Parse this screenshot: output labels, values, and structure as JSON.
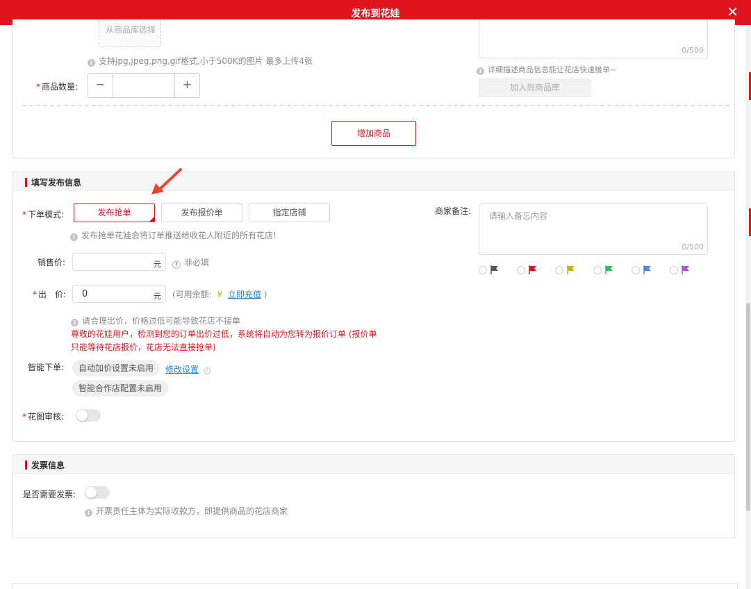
{
  "window": {
    "title": "发布到花娃",
    "close_symbol": "✕"
  },
  "product": {
    "library_select_label": "从商品库选择",
    "upload_hint": "支持jpg,jpeg,png,gif格式,小于500K的图片 最多上传4张",
    "description_count": "0/500",
    "description_hint": "详细描述商品信息能让花店快速接单~",
    "add_to_library_label": "加入到商品库",
    "quantity_label": "商品数量:",
    "quantity_value": "",
    "minus_symbol": "−",
    "plus_symbol": "+",
    "add_product_label": "增加商品"
  },
  "publish": {
    "section_title": "填写发布信息",
    "order_mode_label": "下单模式:",
    "modes": [
      "发布抢单",
      "发布报价单",
      "指定店铺"
    ],
    "selected_mode": "发布抢单",
    "mode_hint": "发布抢单花娃会将订单推送给收花人附近的所有花店!",
    "sale_price_label": "销售价:",
    "sale_price_value": "",
    "currency_unit": "元",
    "optional_hint": "非必填",
    "offer_label": "出　价:",
    "offer_value": "0",
    "balance_prefix": "(可用余额:",
    "balance_symbol": "¥",
    "recharge_link": "立即充值",
    "balance_suffix": ")",
    "offer_hint": "请合理出价，价格过低可能导致花店不接单",
    "warning_line1": "尊敬的花娃用户，检测到您的订单出价过低，系统将自动为您转为报价订单 (报价单",
    "warning_line2": "只能等待花店报价，花店无法直接抢单)",
    "smart_order_label": "智能下单:",
    "auto_raise_status": "自动加价设置未启用",
    "modify_settings_link": "修改设置",
    "coop_shop_status": "智能合作店配置未启用",
    "photo_review_label": "花图审核:",
    "photo_review_enabled": false,
    "remark_label": "商家备注:",
    "remark_placeholder": "请输入备忘内容",
    "remark_count": "0/500",
    "flag_colors": [
      "#555555",
      "#e0141f",
      "#c9b31a",
      "#2bbf6a",
      "#4f86e8",
      "#b44fd6"
    ]
  },
  "invoice": {
    "section_title": "发票信息",
    "need_invoice_label": "是否需要发票:",
    "need_invoice_enabled": false,
    "invoice_hint": "开票责任主体为实际收款方，即提供商品的花店商家"
  },
  "colors": {
    "brand_red": "#e0141f",
    "link_blue": "#1b7fd4",
    "annotation_arrow": "#e8452c"
  }
}
